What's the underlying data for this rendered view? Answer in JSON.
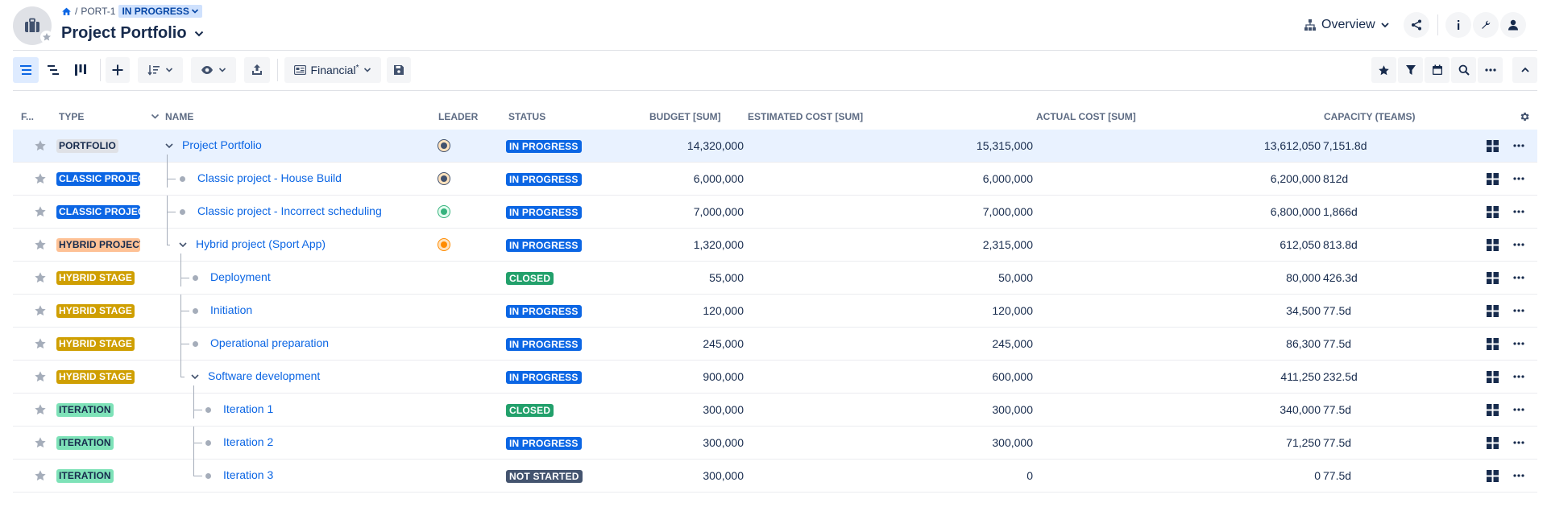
{
  "breadcrumb": {
    "project_key": "PORT-1",
    "status": "IN PROGRESS"
  },
  "page": {
    "title": "Project Portfolio"
  },
  "header": {
    "view_label": "Overview"
  },
  "toolbar": {
    "view_selector": "Financial",
    "view_selector_suffix": "*"
  },
  "table": {
    "headers": {
      "flag": "F...",
      "type": "TYPE",
      "name": "NAME",
      "leader": "LEADER",
      "status": "STATUS",
      "budget": "BUDGET [SUM]",
      "estimated": "ESTIMATED COST [SUM]",
      "actual": "ACTUAL COST [SUM]",
      "capacity": "CAPACITY (TEAMS)"
    },
    "rows": [
      {
        "type": "PORTFOLIO",
        "name": "Project Portfolio",
        "status": "IN PROGRESS",
        "budget": "14,320,000",
        "estimated": "15,315,000",
        "actual": "13,612,050",
        "capacity": "7,151.8d"
      },
      {
        "type": "CLASSIC PROJECT",
        "name": "Classic project - House Build",
        "status": "IN PROGRESS",
        "budget": "6,000,000",
        "estimated": "6,000,000",
        "actual": "6,200,000",
        "capacity": "812d"
      },
      {
        "type": "CLASSIC PROJECT",
        "name": "Classic project - Incorrect scheduling",
        "status": "IN PROGRESS",
        "budget": "7,000,000",
        "estimated": "7,000,000",
        "actual": "6,800,000",
        "capacity": "1,866d"
      },
      {
        "type": "HYBRID PROJECT",
        "name": "Hybrid project (Sport App)",
        "status": "IN PROGRESS",
        "budget": "1,320,000",
        "estimated": "2,315,000",
        "actual": "612,050",
        "capacity": "813.8d"
      },
      {
        "type": "HYBRID STAGE",
        "name": "Deployment",
        "status": "CLOSED",
        "budget": "55,000",
        "estimated": "50,000",
        "actual": "80,000",
        "capacity": "426.3d"
      },
      {
        "type": "HYBRID STAGE",
        "name": "Initiation",
        "status": "IN PROGRESS",
        "budget": "120,000",
        "estimated": "120,000",
        "actual": "34,500",
        "capacity": "77.5d"
      },
      {
        "type": "HYBRID STAGE",
        "name": "Operational preparation",
        "status": "IN PROGRESS",
        "budget": "245,000",
        "estimated": "245,000",
        "actual": "86,300",
        "capacity": "77.5d"
      },
      {
        "type": "HYBRID STAGE",
        "name": "Software development",
        "status": "IN PROGRESS",
        "budget": "900,000",
        "estimated": "600,000",
        "actual": "411,250",
        "capacity": "232.5d"
      },
      {
        "type": "ITERATION",
        "name": "Iteration 1",
        "status": "CLOSED",
        "budget": "300,000",
        "estimated": "300,000",
        "actual": "340,000",
        "capacity": "77.5d"
      },
      {
        "type": "ITERATION",
        "name": "Iteration 2",
        "status": "IN PROGRESS",
        "budget": "300,000",
        "estimated": "300,000",
        "actual": "71,250",
        "capacity": "77.5d"
      },
      {
        "type": "ITERATION",
        "name": "Iteration 3",
        "status": "NOT STARTED",
        "budget": "300,000",
        "estimated": "0",
        "actual": "0",
        "capacity": "77.5d"
      }
    ]
  },
  "colors": {
    "link": "#0c66e4",
    "status_in_progress": "#0c66e4",
    "status_closed": "#22a06b",
    "status_not_started": "#44546f",
    "type_portfolio": "#dfe1e6",
    "type_classic": "#0c66e4",
    "type_hybrid_project": "#fec195",
    "type_hybrid_stage": "#cf9f02",
    "type_iteration": "#7ee2b8"
  },
  "icons": {
    "logo": "briefcase-icon",
    "home": "home-icon",
    "share": "share-icon",
    "info": "info-icon",
    "admin": "wrench-icon",
    "user": "user-icon",
    "favorite": "star-icon",
    "row_actions": "more-icon",
    "widgets": "grid-icon"
  }
}
